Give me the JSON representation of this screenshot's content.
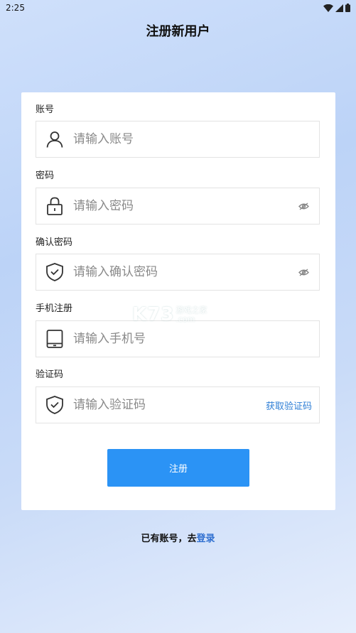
{
  "status_bar": {
    "time": "2:25"
  },
  "header": {
    "title": "注册新用户"
  },
  "form": {
    "account": {
      "label": "账号",
      "placeholder": "请输入账号"
    },
    "password": {
      "label": "密码",
      "placeholder": "请输入密码"
    },
    "confirm_password": {
      "label": "确认密码",
      "placeholder": "请输入确认密码"
    },
    "phone": {
      "label": "手机注册",
      "placeholder": "请输入手机号"
    },
    "code": {
      "label": "验证码",
      "placeholder": "请输入验证码",
      "get_code_label": "获取验证码"
    },
    "submit_label": "注册"
  },
  "footer": {
    "prefix": "已有账号，去",
    "login_link": "登录"
  },
  "watermark": {
    "logo": "K73",
    "line1": "游戏之家",
    "line2": ".com"
  },
  "colors": {
    "primary": "#2b93f5",
    "link": "#2f6fd0"
  },
  "icons": {
    "account": "user-icon",
    "password": "lock-icon",
    "confirm_password": "shield-check-icon",
    "phone": "tablet-icon",
    "code": "shield-check-icon",
    "toggle_visibility": "eye-off-icon"
  }
}
